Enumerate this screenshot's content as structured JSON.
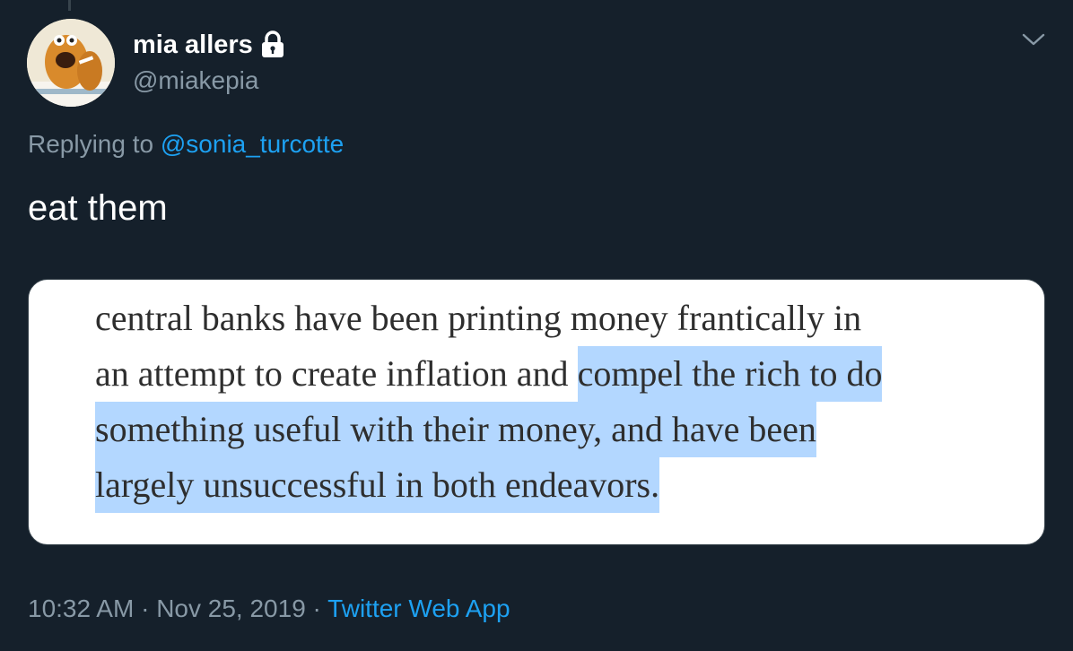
{
  "user": {
    "display_name": "mia allers",
    "handle": "@miakepia"
  },
  "reply": {
    "prefix": "Replying to ",
    "mention": "@sonia_turcotte"
  },
  "tweet": {
    "text": "eat them"
  },
  "image_card": {
    "lines": [
      {
        "plain": "central banks have been printing money frantically in",
        "highlight": ""
      },
      {
        "plain": "an attempt to create inflation and ",
        "highlight": "compel the rich to do"
      },
      {
        "plain": "",
        "highlight": "something useful with their money, and have been"
      },
      {
        "plain": "",
        "highlight": "largely unsuccessful in both endeavors."
      }
    ],
    "highlight_color": "#b3d7ff"
  },
  "meta": {
    "time": "10:32 AM",
    "separator": " · ",
    "date": "Nov 25, 2019",
    "source": "Twitter Web App"
  },
  "icons": {
    "lock": "lock-icon",
    "chevron": "chevron-down-icon"
  },
  "colors": {
    "background": "#15202b",
    "accent": "#1da1f2",
    "secondary_text": "#8899a6"
  }
}
